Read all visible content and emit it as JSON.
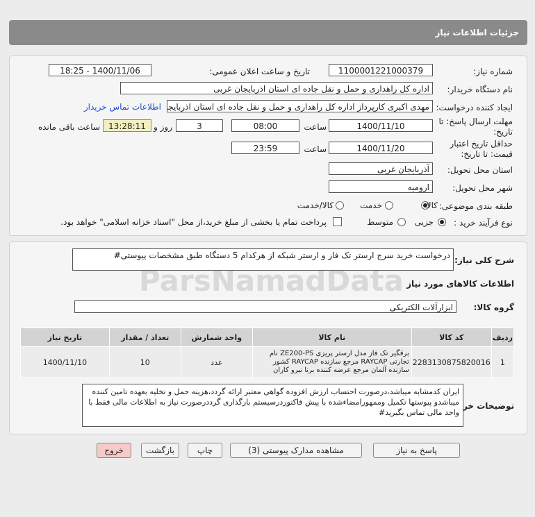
{
  "header": {
    "title": "جزئیات اطلاعات نیاز"
  },
  "form": {
    "need_number_label": "شماره نیاز:",
    "need_number": "1100001221000379",
    "announce_label": "تاریخ و ساعت اعلان عمومی:",
    "announce_value": "1400/11/06 - 18:25",
    "buyer_org_label": "نام دستگاه خریدار:",
    "buyer_org": "اداره کل راهداری و حمل و نقل جاده ای استان اذربایجان غربی",
    "creator_label": "ایجاد کننده درخواست:",
    "creator": "مهدی اکبری کارپرداز اداره کل راهداری و حمل و نقل جاده ای استان اذربایجان غ",
    "contact_link": "اطلاعات تماس خریدار",
    "deadline_label_1": "مهلت ارسال پاسخ: تا",
    "deadline_label_2": "تاریخ:",
    "deadline_date": "1400/11/10",
    "time_label": "ساعت",
    "deadline_time": "08:00",
    "days_value": "3",
    "days_label": "روز و",
    "remaining_time": "13:28:11",
    "remaining_label": "ساعت باقی مانده",
    "validity_label_1": "حداقل تاریخ اعتبار",
    "validity_label_2": "قیمت: تا تاریخ:",
    "validity_date": "1400/11/20",
    "validity_time": "23:59",
    "province_label": "استان محل تحویل:",
    "province": "آذربایجان غربی",
    "city_label": "شهر محل تحویل:",
    "city": "ارومیه",
    "category_label": "طبقه بندی موضوعی:",
    "category_options": [
      "کالا",
      "خدمت",
      "کالا/خدمت"
    ],
    "category_selected": "کالا",
    "process_label": "نوع فرآیند خرید :",
    "process_options": [
      "جزیی",
      "متوسط"
    ],
    "process_selected": "جزیی",
    "payment_note": "پرداخت تمام یا بخشی از مبلغ خرید،از محل \"اسناد خزانه اسلامی\" خواهد بود."
  },
  "details": {
    "summary_label": "شرح کلی نیاز:",
    "summary": "درخواست خرید سرج ارستر تک فاز و ارستر شبکه از هرکدام 5 دستگاه طبق مشخصات پیوستی#",
    "goods_info_title": "اطلاعات کالاهای مورد نیاز",
    "goods_group_label": "گروه کالا:",
    "goods_group": "ابزارآلات الکتریکی",
    "table": {
      "headers": [
        "ردیف",
        "کد کالا",
        "نام کالا",
        "واحد شمارش",
        "تعداد / مقدار",
        "تاریخ نیاز"
      ],
      "rows": [
        {
          "row": "1",
          "code": "2283130875820016",
          "name": "برقگیر تک فاز مدل ارستر پریزی ZE200-PS نام تجارتی RAYCAP مرجع سازنده RAYCAP کشور سازنده آلمان مرجع عرضه کننده برنا نیرو کاران",
          "unit": "عدد",
          "qty": "10",
          "date": "1400/11/10"
        }
      ]
    },
    "buyer_notes_label": "توضیحات خریدار:",
    "buyer_notes": "ایران کدمشابه میباشد،درصورت احتساب ارزش افزوده گواهی معتبر ارائه گردد،هزینه حمل و تخلیه بعهده تامین کننده میباشدو پیوستها تکمیل وممهورامضاءشده با پیش فاکتوردرسیستم بارگذاری گرددرصورت نیاز به اطلاعات مالی فقط با واحد مالی تماس بگیرید#"
  },
  "buttons": {
    "reply": "پاسخ به نیاز",
    "attachments": "مشاهده مدارک پیوستی (3)",
    "print": "چاپ",
    "back": "بازگشت",
    "exit": "خروج"
  },
  "watermark": "ParsNamadData",
  "colors": {
    "header_bg": "#8a8a8a",
    "link": "#1a4fd0",
    "highlight": "#f2f0c0",
    "exit_btn": "#f7caca"
  }
}
